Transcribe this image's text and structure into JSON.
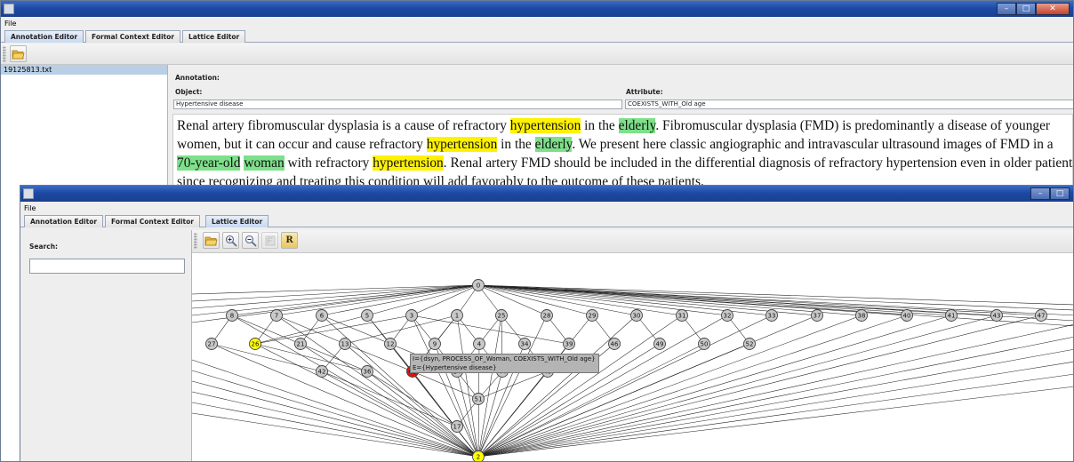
{
  "back": {
    "menu_file": "File",
    "tabs": [
      "Annotation Editor",
      "Formal Context Editor",
      "Lattice Editor"
    ],
    "file_list": [
      "19125813.txt"
    ],
    "annotation_label": "Annotation:",
    "object_label": "Object:",
    "object_value": "Hypertensive disease",
    "attribute_label": "Attribute:",
    "attribute_value": "COEXISTS_WITH_Old age",
    "text": {
      "l1a": "Renal artery fibromuscular dysplasia is a cause of refractory ",
      "l1b": "hypertension",
      "l1c": " in the ",
      "l1d": "elderly",
      "l1e": ". Fibromuscular dysplasia (FMD) is predominantly a disease of younger",
      "l2a": "women, but it can occur and cause refractory ",
      "l2b": "hypertension",
      "l2c": " in the ",
      "l2d": "elderly",
      "l2e": ". We present here classic angiographic and intravascular ultrasound images of FMD in a",
      "l3a": "70-year-old",
      "l3b": " ",
      "l3c": "woman",
      "l3d": " with refractory ",
      "l3e": "hypertension",
      "l3f": ". Renal artery FMD should be included in the differential diagnosis of refractory hypertension even in older patients",
      "l4": "since recognizing and treating this condition will add favorably to the outcome of these patients."
    },
    "highlight_colors": {
      "yellow": "#fff200",
      "green": "#7ee08a"
    }
  },
  "front": {
    "menu_file": "File",
    "tabs": [
      "Annotation Editor",
      "Formal Context Editor",
      "Lattice Editor"
    ],
    "search_label": "Search:",
    "search_value": "",
    "toolbar_icons": [
      "open-icon",
      "zoom-in-icon",
      "zoom-out-icon",
      "fit-icon",
      "reset-icon"
    ],
    "reset_label": "R",
    "tooltip_line1": "I={dsyn, PROCESS_OF_Woman, COEXISTS_WITH_Old age}",
    "tooltip_line2": "E={Hypertensive disease}",
    "lattice": {
      "top": "0",
      "row1": [
        "8",
        "7",
        "6",
        "5",
        "3",
        "1",
        "25",
        "28",
        "29",
        "30",
        "31",
        "32",
        "33",
        "37",
        "38",
        "40",
        "41",
        "43",
        "47"
      ],
      "row2": [
        "27",
        "26",
        "21",
        "13",
        "12",
        "9",
        "4",
        "34",
        "39",
        "46",
        "49",
        "50",
        "52"
      ],
      "row3": [
        "42",
        "36",
        "48",
        "14",
        "44",
        "45"
      ],
      "row4": [
        "51"
      ],
      "row5": [
        "17"
      ],
      "bottom": "2",
      "highlighted_yellow": [
        "26",
        "2"
      ],
      "highlighted_red": [
        "48"
      ],
      "colors": {
        "node": "#c9c9c9",
        "yellow": "#ffff00",
        "red": "#dd1111"
      }
    }
  }
}
